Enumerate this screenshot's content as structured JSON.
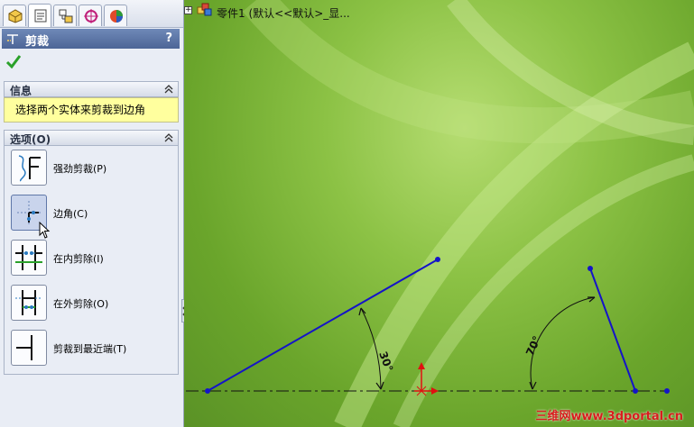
{
  "panel": {
    "tabs": [
      "feature-manager-icon",
      "property-manager-icon",
      "configuration-manager-icon",
      "dimxpert-icon",
      "display-manager-icon"
    ],
    "title": "剪裁",
    "help": "?",
    "info": {
      "header": "信息",
      "message": "选择两个实体来剪裁到边角"
    },
    "options": {
      "header": "选项(O)",
      "items": [
        {
          "label": "强劲剪裁(P)",
          "icon": "power-trim-icon"
        },
        {
          "label": "边角(C)",
          "icon": "corner-trim-icon"
        },
        {
          "label": "在内剪除(I)",
          "icon": "trim-inside-icon"
        },
        {
          "label": "在外剪除(O)",
          "icon": "trim-outside-icon"
        },
        {
          "label": "剪裁到最近端(T)",
          "icon": "trim-to-closest-icon"
        }
      ]
    }
  },
  "viewport": {
    "tree_label": "零件1  (默认<<默认>_显...",
    "angle_left": "30°",
    "angle_right": "70°",
    "watermark": "三维网www.3dportal.cn"
  },
  "colors": {
    "sketch_line": "#1414c8",
    "dimension": "#111111",
    "origin": "#e01010",
    "titlebar": "#4c6596",
    "info_bg": "#ffff9e"
  }
}
